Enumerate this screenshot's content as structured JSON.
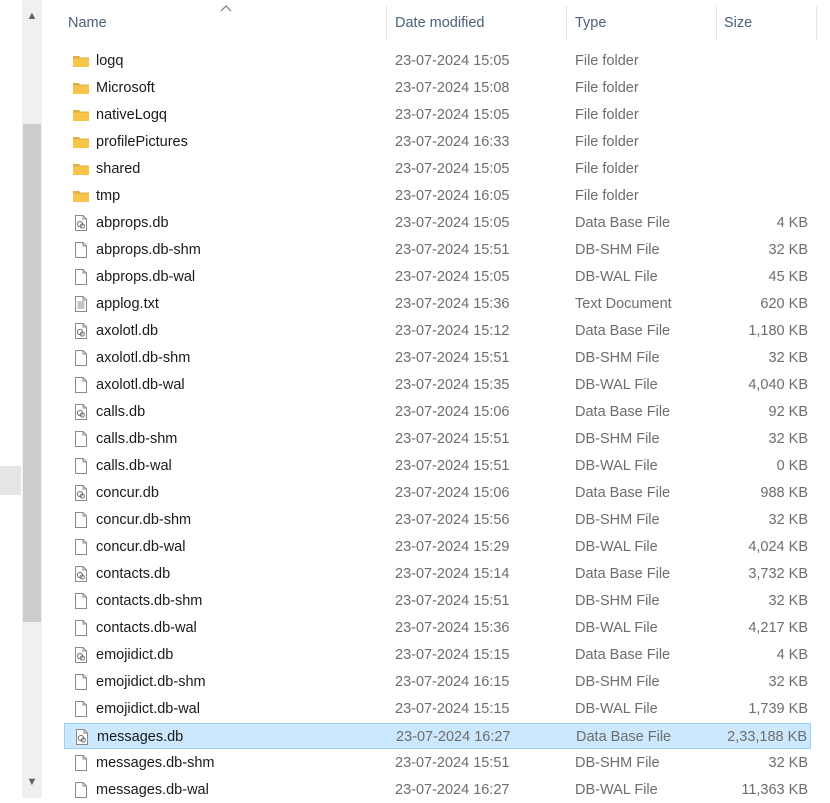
{
  "columns": {
    "name": "Name",
    "date": "Date modified",
    "type": "Type",
    "size": "Size"
  },
  "sort": {
    "column": "name",
    "direction": "ascending"
  },
  "colors": {
    "selected_bg": "#cce8ff",
    "selected_border": "#99d1ff",
    "folder": "#f8c548",
    "header_text": "#4c607a"
  },
  "rows": [
    {
      "name": "logq",
      "date": "23-07-2024 15:05",
      "type": "File folder",
      "size": "",
      "icon": "folder-icon"
    },
    {
      "name": "Microsoft",
      "date": "23-07-2024 15:08",
      "type": "File folder",
      "size": "",
      "icon": "folder-icon"
    },
    {
      "name": "nativeLogq",
      "date": "23-07-2024 15:05",
      "type": "File folder",
      "size": "",
      "icon": "folder-icon"
    },
    {
      "name": "profilePictures",
      "date": "23-07-2024 16:33",
      "type": "File folder",
      "size": "",
      "icon": "folder-icon"
    },
    {
      "name": "shared",
      "date": "23-07-2024 15:05",
      "type": "File folder",
      "size": "",
      "icon": "folder-icon"
    },
    {
      "name": "tmp",
      "date": "23-07-2024 16:05",
      "type": "File folder",
      "size": "",
      "icon": "folder-icon"
    },
    {
      "name": "abprops.db",
      "date": "23-07-2024 15:05",
      "type": "Data Base File",
      "size": "4 KB",
      "icon": "database-file-icon"
    },
    {
      "name": "abprops.db-shm",
      "date": "23-07-2024 15:51",
      "type": "DB-SHM File",
      "size": "32 KB",
      "icon": "blank-file-icon"
    },
    {
      "name": "abprops.db-wal",
      "date": "23-07-2024 15:05",
      "type": "DB-WAL File",
      "size": "45 KB",
      "icon": "blank-file-icon"
    },
    {
      "name": "applog.txt",
      "date": "23-07-2024 15:36",
      "type": "Text Document",
      "size": "620 KB",
      "icon": "text-file-icon"
    },
    {
      "name": "axolotl.db",
      "date": "23-07-2024 15:12",
      "type": "Data Base File",
      "size": "1,180 KB",
      "icon": "database-file-icon"
    },
    {
      "name": "axolotl.db-shm",
      "date": "23-07-2024 15:51",
      "type": "DB-SHM File",
      "size": "32 KB",
      "icon": "blank-file-icon"
    },
    {
      "name": "axolotl.db-wal",
      "date": "23-07-2024 15:35",
      "type": "DB-WAL File",
      "size": "4,040 KB",
      "icon": "blank-file-icon"
    },
    {
      "name": "calls.db",
      "date": "23-07-2024 15:06",
      "type": "Data Base File",
      "size": "92 KB",
      "icon": "database-file-icon"
    },
    {
      "name": "calls.db-shm",
      "date": "23-07-2024 15:51",
      "type": "DB-SHM File",
      "size": "32 KB",
      "icon": "blank-file-icon"
    },
    {
      "name": "calls.db-wal",
      "date": "23-07-2024 15:51",
      "type": "DB-WAL File",
      "size": "0 KB",
      "icon": "blank-file-icon"
    },
    {
      "name": "concur.db",
      "date": "23-07-2024 15:06",
      "type": "Data Base File",
      "size": "988 KB",
      "icon": "database-file-icon"
    },
    {
      "name": "concur.db-shm",
      "date": "23-07-2024 15:56",
      "type": "DB-SHM File",
      "size": "32 KB",
      "icon": "blank-file-icon"
    },
    {
      "name": "concur.db-wal",
      "date": "23-07-2024 15:29",
      "type": "DB-WAL File",
      "size": "4,024 KB",
      "icon": "blank-file-icon"
    },
    {
      "name": "contacts.db",
      "date": "23-07-2024 15:14",
      "type": "Data Base File",
      "size": "3,732 KB",
      "icon": "database-file-icon"
    },
    {
      "name": "contacts.db-shm",
      "date": "23-07-2024 15:51",
      "type": "DB-SHM File",
      "size": "32 KB",
      "icon": "blank-file-icon"
    },
    {
      "name": "contacts.db-wal",
      "date": "23-07-2024 15:36",
      "type": "DB-WAL File",
      "size": "4,217 KB",
      "icon": "blank-file-icon"
    },
    {
      "name": "emojidict.db",
      "date": "23-07-2024 15:15",
      "type": "Data Base File",
      "size": "4 KB",
      "icon": "database-file-icon"
    },
    {
      "name": "emojidict.db-shm",
      "date": "23-07-2024 16:15",
      "type": "DB-SHM File",
      "size": "32 KB",
      "icon": "blank-file-icon"
    },
    {
      "name": "emojidict.db-wal",
      "date": "23-07-2024 15:15",
      "type": "DB-WAL File",
      "size": "1,739 KB",
      "icon": "blank-file-icon"
    },
    {
      "name": "messages.db",
      "date": "23-07-2024 16:27",
      "type": "Data Base File",
      "size": "2,33,188 KB",
      "icon": "database-file-icon",
      "selected": true
    },
    {
      "name": "messages.db-shm",
      "date": "23-07-2024 15:51",
      "type": "DB-SHM File",
      "size": "32 KB",
      "icon": "blank-file-icon"
    },
    {
      "name": "messages.db-wal",
      "date": "23-07-2024 16:27",
      "type": "DB-WAL File",
      "size": "11,363 KB",
      "icon": "blank-file-icon"
    }
  ]
}
